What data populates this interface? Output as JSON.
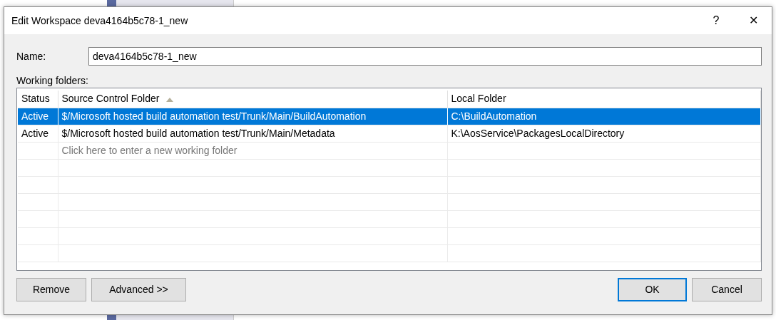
{
  "window": {
    "title": "Edit Workspace deva4164b5c78-1_new",
    "help": "?",
    "close": "✕"
  },
  "name_field": {
    "label": "Name:",
    "value": "deva4164b5c78-1_new"
  },
  "working_folders": {
    "label": "Working folders:",
    "columns": [
      {
        "label": "Status",
        "sorted": false
      },
      {
        "label": "Source Control Folder",
        "sorted": true
      },
      {
        "label": "Local Folder",
        "sorted": false
      }
    ],
    "rows": [
      {
        "status": "Active",
        "source": "$/Microsoft hosted build automation test/Trunk/Main/BuildAutomation",
        "local": "C:\\BuildAutomation",
        "selected": true
      },
      {
        "status": "Active",
        "source": "$/Microsoft hosted build automation test/Trunk/Main/Metadata",
        "local": "K:\\AosService\\PackagesLocalDirectory",
        "selected": false
      }
    ],
    "new_row_placeholder": "Click here to enter a new working folder"
  },
  "buttons": [
    {
      "label": "Remove",
      "default": false
    },
    {
      "label": "Advanced >>",
      "default": false
    },
    {
      "label": "OK",
      "default": true
    },
    {
      "label": "Cancel",
      "default": false
    }
  ]
}
